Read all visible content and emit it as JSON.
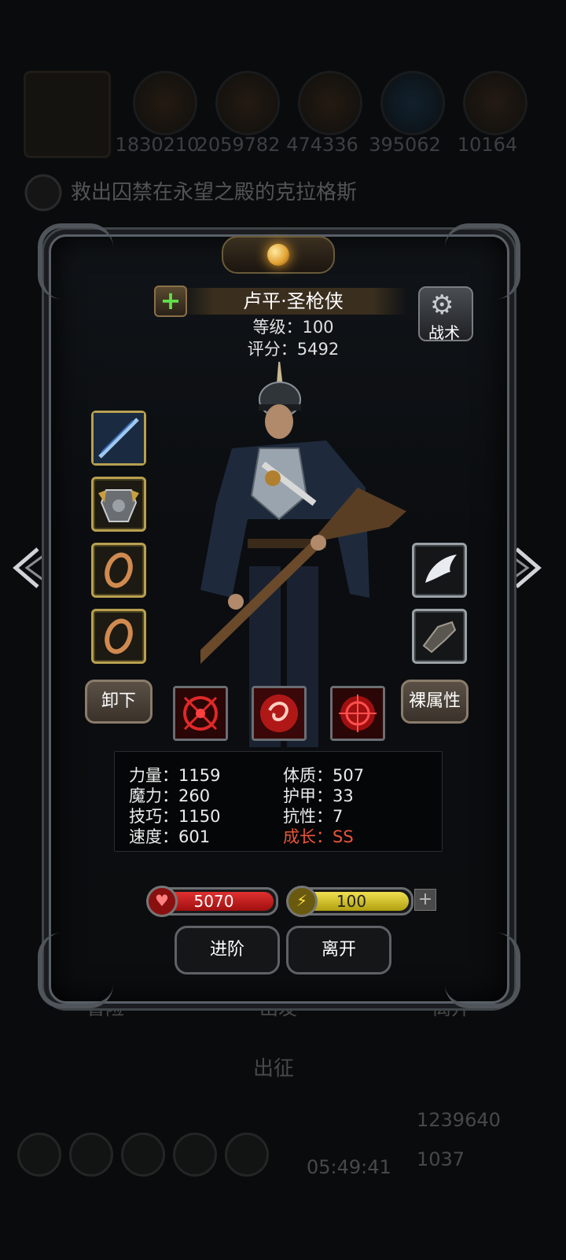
{
  "background": {
    "resources": [
      "1830210",
      "2059782",
      "474336",
      "395062",
      "10164"
    ],
    "quest_text": "救出囚禁在永望之殿的克拉格斯",
    "tabs": [
      "冒险",
      "出发",
      "离开"
    ],
    "expedition_label": "出征",
    "timer": "05:49:41",
    "gold": "1239640",
    "gems": "1037"
  },
  "hero": {
    "name": "卢平·圣枪侠",
    "level_label": "等级：100",
    "score_label": "评分：5492"
  },
  "buttons": {
    "tactics": "战术",
    "unequip": "卸下",
    "base_attributes": "裸属性",
    "advance": "进阶",
    "leave": "离开"
  },
  "stats": {
    "strength": "力量：1159",
    "magic": "魔力：260",
    "skill": "技巧：1150",
    "speed": "速度：601",
    "constitution": "体质：507",
    "armor": "护甲：33",
    "resistance": "抗性：7",
    "growth": "成长：SS"
  },
  "bars": {
    "hp": "5070",
    "energy": "100"
  },
  "colors": {
    "hp_fill": "#c81e1e",
    "energy_fill": "#d8c028",
    "growth_text": "#e8553a",
    "gold_slot_border": "#b8a050"
  },
  "icons": {
    "left_arrow": "chevron-left-icon",
    "right_arrow": "chevron-right-icon",
    "plus": "plus-icon",
    "tactics": "gear-icon",
    "hp": "heart-icon",
    "energy": "lightning-icon"
  }
}
